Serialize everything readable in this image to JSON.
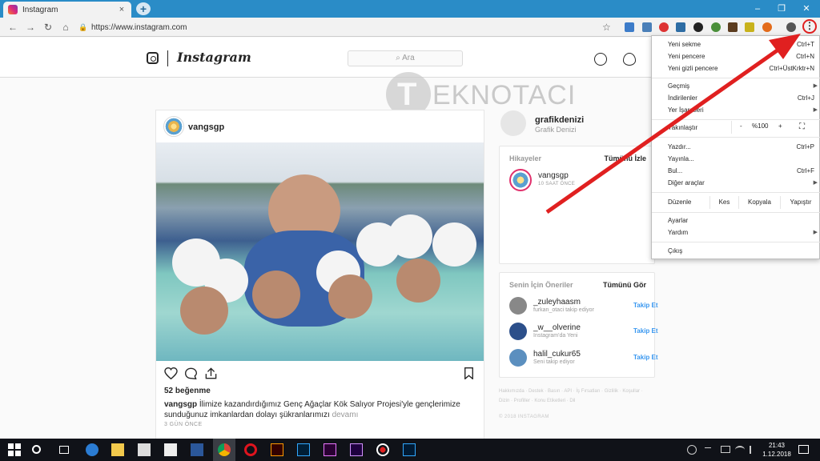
{
  "browser": {
    "tab_title": "Instagram",
    "tab_close": "×",
    "new_tab": "+",
    "window_minimize": "–",
    "window_restore": "❐",
    "window_close": "✕",
    "url": "https://www.instagram.com",
    "menu_button": "⋮"
  },
  "instagram": {
    "logo_text": "Instagram",
    "search_placeholder": "⌕ Ara",
    "post": {
      "username": "vangsgp",
      "likes": "52 beğenme",
      "caption_user": "vangsgp",
      "caption_text": " İlimize kazandırdığımız Genç Ağaçlar Kök Salıyor Projesi'yle gençlerimize sunduğunuz imkanlardan dolayı şükranlarımızı ",
      "caption_more": "devamı",
      "time": "3 GÜN ÖNCE"
    },
    "profile": {
      "username": "grafikdenizi",
      "full_name": "Grafik Denizi"
    },
    "stories": {
      "title": "Hikayeler",
      "view_all": "Tümünü İzle",
      "items": [
        {
          "name": "vangsgp",
          "time": "10 SAAT ÖNCE"
        }
      ]
    },
    "suggestions": {
      "title": "Senin İçin Öneriler",
      "view_all": "Tümünü Gör",
      "items": [
        {
          "name": "_zuleyhaasm",
          "sub": "furkan_otaci takip ediyor",
          "action": "Takip Et"
        },
        {
          "name": "_w__olverine",
          "sub": "Instagram'da Yeni",
          "action": "Takip Et"
        },
        {
          "name": "halil_cukur65",
          "sub": "Seni takip ediyor",
          "action": "Takip Et"
        }
      ]
    },
    "footer_links": "Hakkımızda · Destek · Basın · API · İş Fırsatları · Gizlilik · Koşullar · Dizin · Profiller · Konu Etiketleri · Dil",
    "copyright": "© 2018 INSTAGRAM"
  },
  "watermark": {
    "letter": "T",
    "text": "EKNOTACI"
  },
  "chrome_menu": {
    "new_tab": {
      "label": "Yeni sekme",
      "shortcut": "Ctrl+T"
    },
    "new_window": {
      "label": "Yeni pencere",
      "shortcut": "Ctrl+N"
    },
    "incognito": {
      "label": "Yeni gizli pencere",
      "shortcut": "Ctrl+ÜstKrktr+N"
    },
    "history": {
      "label": "Geçmiş"
    },
    "downloads": {
      "label": "İndirilenler",
      "shortcut": "Ctrl+J"
    },
    "bookmarks": {
      "label": "Yer İşaretleri"
    },
    "zoom": {
      "label": "Yakınlaştır",
      "minus": "-",
      "value": "%100",
      "plus": "+",
      "fullscreen": "⛶"
    },
    "print": {
      "label": "Yazdır...",
      "shortcut": "Ctrl+P"
    },
    "cast": {
      "label": "Yayınla..."
    },
    "find": {
      "label": "Bul...",
      "shortcut": "Ctrl+F"
    },
    "more_tools": {
      "label": "Diğer araçlar"
    },
    "edit": {
      "label": "Düzenle",
      "cut": "Kes",
      "copy": "Kopyala",
      "paste": "Yapıştır"
    },
    "settings": {
      "label": "Ayarlar"
    },
    "help": {
      "label": "Yardım"
    },
    "exit": {
      "label": "Çıkış"
    }
  },
  "taskbar": {
    "time": "21:43",
    "date": "1.12.2018"
  },
  "colors": {
    "chrome_blue": "#2a8cc7",
    "instagram_link": "#3897f0",
    "annotation_red": "#e02020"
  }
}
